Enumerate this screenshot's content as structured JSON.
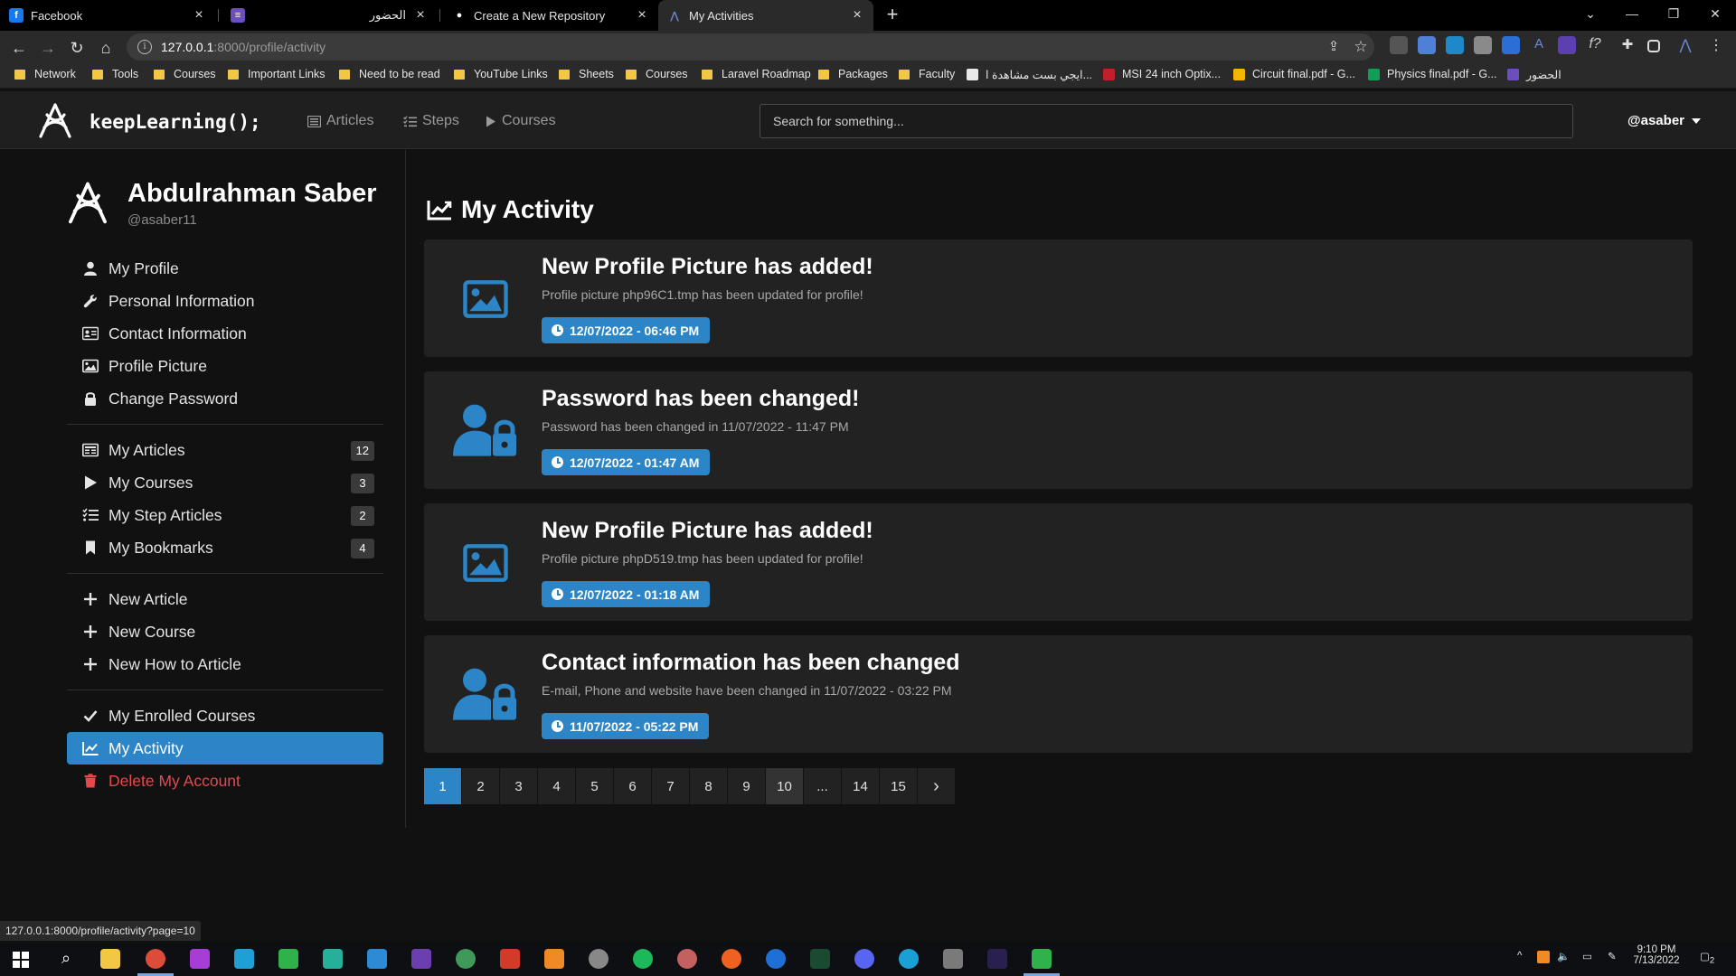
{
  "browser": {
    "tabs": [
      {
        "title": "Facebook",
        "icon": "facebook-icon",
        "color": "#1877f2",
        "glyph": "f"
      },
      {
        "title": "الحضور",
        "icon": "forms-icon",
        "color": "#6b4fbb",
        "glyph": "≡"
      },
      {
        "title": "Create a New Repository",
        "icon": "github-icon",
        "color": "#000000",
        "glyph": "●"
      },
      {
        "title": "My Activities",
        "icon": "site-icon",
        "color": "#2a2a2a",
        "glyph": "⋀"
      }
    ],
    "close_glyph": "×",
    "new_tab_glyph": "+",
    "address": {
      "host": "127.0.0.1",
      "path": ":8000/profile/activity"
    },
    "bookmarks": [
      {
        "label": "Network",
        "type": "folder"
      },
      {
        "label": "Tools",
        "type": "folder"
      },
      {
        "label": "Courses",
        "type": "folder"
      },
      {
        "label": "Important Links",
        "type": "folder"
      },
      {
        "label": "Need to be read",
        "type": "folder"
      },
      {
        "label": "YouTube Links",
        "type": "folder"
      },
      {
        "label": "Sheets",
        "type": "folder"
      },
      {
        "label": "Courses",
        "type": "folder"
      },
      {
        "label": "Laravel Roadmap",
        "type": "folder"
      },
      {
        "label": "Packages",
        "type": "folder"
      },
      {
        "label": "Faculty",
        "type": "folder"
      },
      {
        "label": "ايجي بست مشاهدة ا...",
        "type": "site",
        "color": "#e8e8e8"
      },
      {
        "label": "MSI 24 inch Optix...",
        "type": "site",
        "color": "#c21f2a"
      },
      {
        "label": "Circuit final.pdf - G...",
        "type": "site",
        "color": "#f4b400"
      },
      {
        "label": "Physics final.pdf - G...",
        "type": "site",
        "color": "#0f9d58"
      },
      {
        "label": "الحضور",
        "type": "site",
        "color": "#6b4fbb"
      }
    ],
    "status_url": "127.0.0.1:8000/profile/activity?page=10"
  },
  "site": {
    "brand": "keepLearning();",
    "nav": [
      {
        "label": "Articles",
        "icon": "newspaper-icon"
      },
      {
        "label": "Steps",
        "icon": "list-check-icon"
      },
      {
        "label": "Courses",
        "icon": "play-icon"
      }
    ],
    "search_placeholder": "Search for something...",
    "user": "@asaber"
  },
  "profile": {
    "name": "Abdulrahman Saber",
    "handle": "@asaber11"
  },
  "sidebar": {
    "group1": [
      {
        "label": "My Profile",
        "icon": "user-icon"
      },
      {
        "label": "Personal Information",
        "icon": "wrench-icon"
      },
      {
        "label": "Contact Information",
        "icon": "address-card-icon"
      },
      {
        "label": "Profile Picture",
        "icon": "image-icon"
      },
      {
        "label": "Change Password",
        "icon": "lock-icon"
      }
    ],
    "group2": [
      {
        "label": "My Articles",
        "icon": "newspaper-icon",
        "count": "12"
      },
      {
        "label": "My Courses",
        "icon": "play-icon",
        "count": "3"
      },
      {
        "label": "My Step Articles",
        "icon": "list-check-icon",
        "count": "2"
      },
      {
        "label": "My Bookmarks",
        "icon": "bookmark-icon",
        "count": "4"
      }
    ],
    "group3": [
      {
        "label": "New Article",
        "icon": "plus-icon"
      },
      {
        "label": "New Course",
        "icon": "plus-icon"
      },
      {
        "label": "New How to Article",
        "icon": "plus-icon"
      }
    ],
    "group4": [
      {
        "label": "My Enrolled Courses",
        "icon": "check-icon"
      },
      {
        "label": "My Activity",
        "icon": "chart-line-icon",
        "active": true
      },
      {
        "label": "Delete My Account",
        "icon": "trash-icon",
        "danger": true
      }
    ]
  },
  "main": {
    "title": "My Activity",
    "activities": [
      {
        "title": "New Profile Picture has added!",
        "text": "Profile picture php96C1.tmp has been updated for profile!",
        "time": "12/07/2022 - 06:46 PM",
        "icon": "image-icon"
      },
      {
        "title": "Password has been changed!",
        "text": "Password has been changed in 11/07/2022 - 11:47 PM",
        "time": "12/07/2022 - 01:47 AM",
        "icon": "user-lock-icon"
      },
      {
        "title": "New Profile Picture has added!",
        "text": "Profile picture phpD519.tmp has been updated for profile!",
        "time": "12/07/2022 - 01:18 AM",
        "icon": "image-icon"
      },
      {
        "title": "Contact information has been changed",
        "text": "E-mail, Phone and website have been changed in 11/07/2022 - 03:22 PM",
        "time": "11/07/2022 - 05:22 PM",
        "icon": "user-lock-icon"
      }
    ],
    "pagination": [
      "1",
      "2",
      "3",
      "4",
      "5",
      "6",
      "7",
      "8",
      "9",
      "10",
      "...",
      "14",
      "15",
      "›"
    ],
    "current_page": "1",
    "hovered_page": "10"
  },
  "taskbar": {
    "time": "9:10 PM",
    "date": "7/13/2022",
    "notifications": "2"
  }
}
